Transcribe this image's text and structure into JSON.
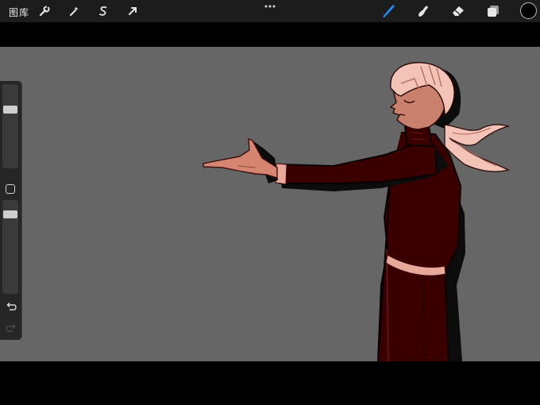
{
  "toolbar": {
    "gallery_label": "图库",
    "left_tools": [
      "wrench-icon",
      "magic-wand-icon",
      "selection-icon",
      "transform-arrow-icon"
    ],
    "right_tools": [
      "brush-icon",
      "smudge-icon",
      "eraser-icon",
      "layers-icon"
    ],
    "active_tool": "brush-icon",
    "active_color": "#1f8cff",
    "current_color": "#000000"
  },
  "canvas": {
    "background": "#666666"
  },
  "sidebar": {
    "brush_size_level": 0.72,
    "opacity_level": 0.88
  }
}
